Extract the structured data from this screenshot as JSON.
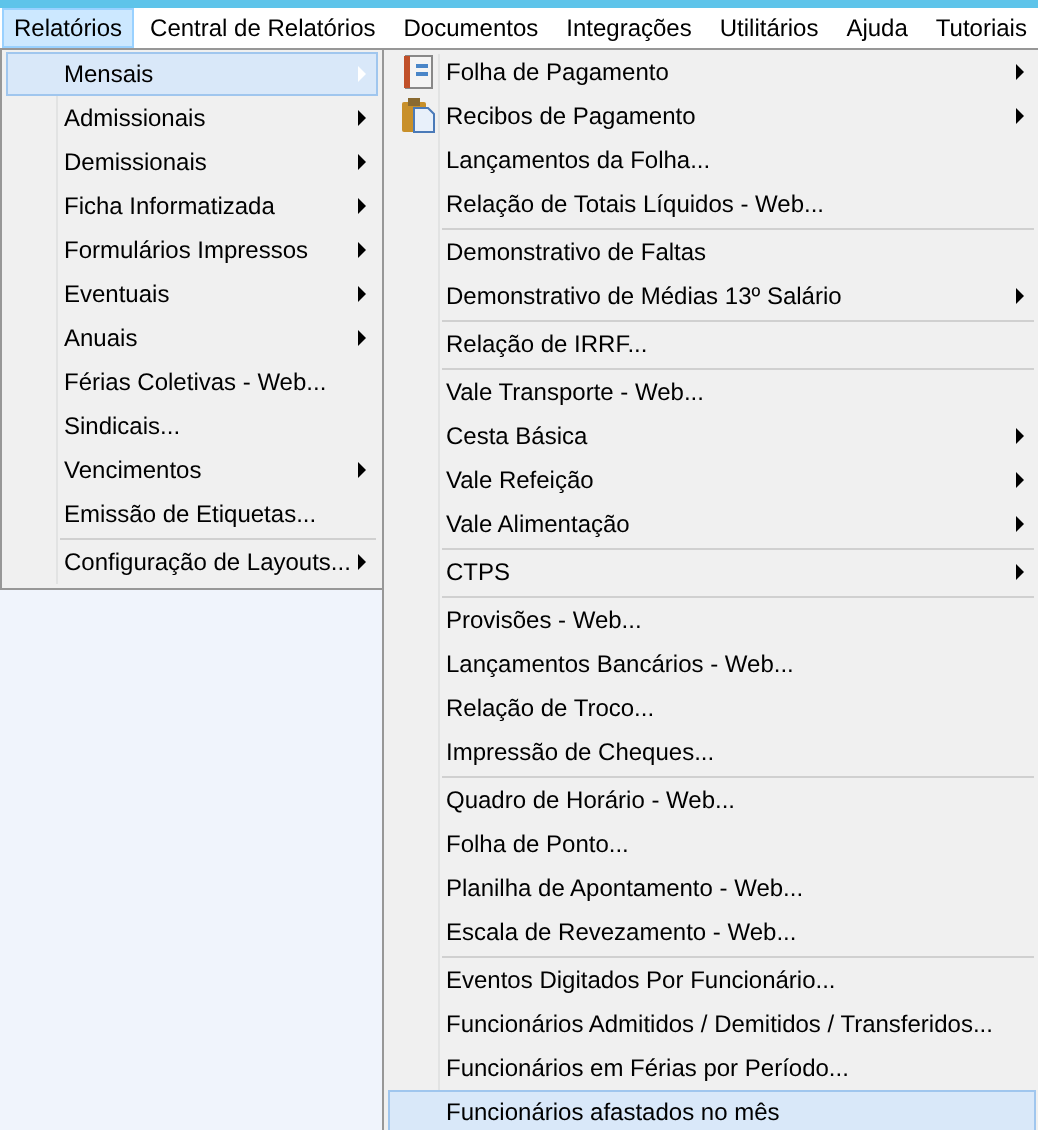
{
  "menubar": [
    {
      "label": "Relatórios",
      "selected": true
    },
    {
      "label": "Central de Relatórios",
      "selected": false
    },
    {
      "label": "Documentos",
      "selected": false
    },
    {
      "label": "Integrações",
      "selected": false
    },
    {
      "label": "Utilitários",
      "selected": false
    },
    {
      "label": "Ajuda",
      "selected": false
    },
    {
      "label": "Tutoriais",
      "selected": false
    }
  ],
  "menu": [
    {
      "label": "Mensais",
      "submenu": true,
      "selected": true,
      "separator_before": false
    },
    {
      "label": "Admissionais",
      "submenu": true,
      "selected": false,
      "separator_before": false
    },
    {
      "label": "Demissionais",
      "submenu": true,
      "selected": false,
      "separator_before": false
    },
    {
      "label": "Ficha Informatizada",
      "submenu": true,
      "selected": false,
      "separator_before": false
    },
    {
      "label": "Formulários Impressos",
      "submenu": true,
      "selected": false,
      "separator_before": false
    },
    {
      "label": "Eventuais",
      "submenu": true,
      "selected": false,
      "separator_before": false
    },
    {
      "label": "Anuais",
      "submenu": true,
      "selected": false,
      "separator_before": false
    },
    {
      "label": "Férias Coletivas - Web...",
      "submenu": false,
      "selected": false,
      "separator_before": false
    },
    {
      "label": "Sindicais...",
      "submenu": false,
      "selected": false,
      "separator_before": false
    },
    {
      "label": "Vencimentos",
      "submenu": true,
      "selected": false,
      "separator_before": false
    },
    {
      "label": "Emissão de Etiquetas...",
      "submenu": false,
      "selected": false,
      "separator_before": false
    },
    {
      "label": "Configuração de Layouts...",
      "submenu": true,
      "selected": false,
      "separator_before": true
    }
  ],
  "submenu": [
    {
      "label": "Folha de Pagamento",
      "submenu": true,
      "selected": false,
      "separator_before": false
    },
    {
      "label": "Recibos de Pagamento",
      "submenu": true,
      "selected": false,
      "separator_before": false
    },
    {
      "label": "Lançamentos da Folha...",
      "submenu": false,
      "selected": false,
      "separator_before": false
    },
    {
      "label": "Relação de Totais Líquidos - Web...",
      "submenu": false,
      "selected": false,
      "separator_before": false
    },
    {
      "label": "Demonstrativo de Faltas",
      "submenu": false,
      "selected": false,
      "separator_before": true
    },
    {
      "label": "Demonstrativo de Médias 13º Salário",
      "submenu": true,
      "selected": false,
      "separator_before": false
    },
    {
      "label": "Relação de IRRF...",
      "submenu": false,
      "selected": false,
      "separator_before": true
    },
    {
      "label": "Vale Transporte - Web...",
      "submenu": false,
      "selected": false,
      "separator_before": true
    },
    {
      "label": "Cesta Básica",
      "submenu": true,
      "selected": false,
      "separator_before": false
    },
    {
      "label": "Vale Refeição",
      "submenu": true,
      "selected": false,
      "separator_before": false
    },
    {
      "label": "Vale Alimentação",
      "submenu": true,
      "selected": false,
      "separator_before": false
    },
    {
      "label": "CTPS",
      "submenu": true,
      "selected": false,
      "separator_before": true
    },
    {
      "label": "Provisões - Web...",
      "submenu": false,
      "selected": false,
      "separator_before": true
    },
    {
      "label": "Lançamentos Bancários - Web...",
      "submenu": false,
      "selected": false,
      "separator_before": false
    },
    {
      "label": "Relação de Troco...",
      "submenu": false,
      "selected": false,
      "separator_before": false
    },
    {
      "label": "Impressão de Cheques...",
      "submenu": false,
      "selected": false,
      "separator_before": false
    },
    {
      "label": "Quadro de Horário - Web...",
      "submenu": false,
      "selected": false,
      "separator_before": true
    },
    {
      "label": "Folha de Ponto...",
      "submenu": false,
      "selected": false,
      "separator_before": false
    },
    {
      "label": "Planilha de Apontamento - Web...",
      "submenu": false,
      "selected": false,
      "separator_before": false
    },
    {
      "label": "Escala de Revezamento - Web...",
      "submenu": false,
      "selected": false,
      "separator_before": false
    },
    {
      "label": "Eventos Digitados Por Funcionário...",
      "submenu": false,
      "selected": false,
      "separator_before": true
    },
    {
      "label": "Funcionários Admitidos / Demitidos / Transferidos...",
      "submenu": false,
      "selected": false,
      "separator_before": false
    },
    {
      "label": "Funcionários em Férias por Período...",
      "submenu": false,
      "selected": false,
      "separator_before": false
    },
    {
      "label": "Funcionários afastados no mês",
      "submenu": false,
      "selected": true,
      "separator_before": false
    }
  ]
}
